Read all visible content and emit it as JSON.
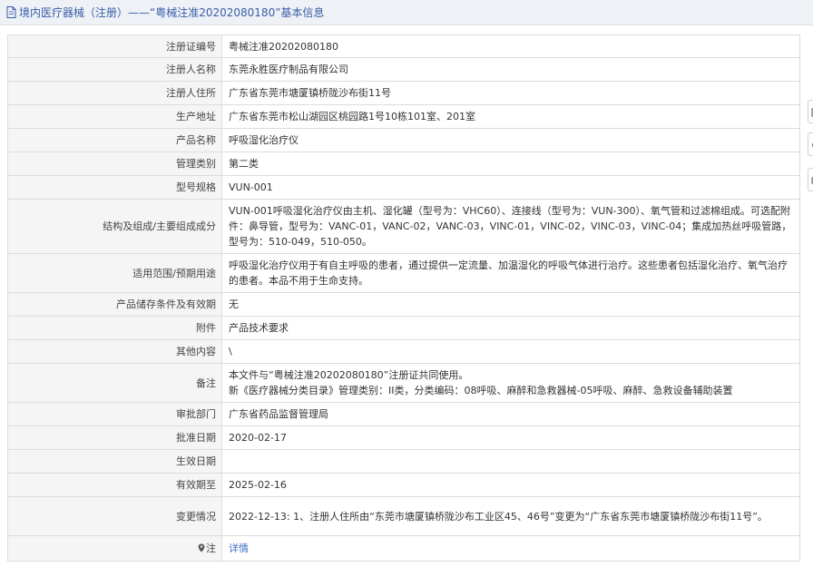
{
  "header": {
    "title": "境内医疗器械（注册）——“粤械注准20202080180”基本信息"
  },
  "rows": [
    {
      "label": "注册证编号",
      "value": "粤械注准20202080180"
    },
    {
      "label": "注册人名称",
      "value": "东莞永胜医疗制品有限公司"
    },
    {
      "label": "注册人住所",
      "value": "广东省东莞市塘厦镇桥陇沙布街11号"
    },
    {
      "label": "生产地址",
      "value": "广东省东莞市松山湖园区桃园路1号10栋101室、201室"
    },
    {
      "label": "产品名称",
      "value": "呼吸湿化治疗仪"
    },
    {
      "label": "管理类别",
      "value": "第二类"
    },
    {
      "label": "型号规格",
      "value": "VUN-001"
    },
    {
      "label": "结构及组成/主要组成成分",
      "value": "VUN-001呼吸湿化治疗仪由主机、湿化罐（型号为：VHC60）、连接线（型号为：VUN-300）、氧气管和过滤棉组成。可选配附件：鼻导管，型号为：VANC-01，VANC-02，VANC-03，VINC-01，VINC-02，VINC-03，VINC-04；集成加热丝呼吸管路，型号为：510-049，510-050。"
    },
    {
      "label": "适用范围/预期用途",
      "value": "呼吸湿化治疗仪用于有自主呼吸的患者，通过提供一定流量、加温湿化的呼吸气体进行治疗。这些患者包括湿化治疗、氧气治疗的患者。本品不用于生命支持。"
    },
    {
      "label": "产品储存条件及有效期",
      "value": "无"
    },
    {
      "label": "附件",
      "value": "产品技术要求"
    },
    {
      "label": "其他内容",
      "value": "\\"
    },
    {
      "label": "备注",
      "value_lines": [
        "本文件与“粤械注准20202080180”注册证共同使用。",
        "新《医疗器械分类目录》管理类别：II类，分类编码：08呼吸、麻醉和急救器械-05呼吸、麻醉、急救设备辅助装置"
      ]
    },
    {
      "label": "审批部门",
      "value": "广东省药品监督管理局"
    },
    {
      "label": "批准日期",
      "value": "2020-02-17"
    },
    {
      "label": "生效日期",
      "value": ""
    },
    {
      "label": "有效期至",
      "value": "2025-02-16"
    },
    {
      "label": "变更情况",
      "value": "2022-12-13: 1、注册人住所由“东莞市塘厦镇桥陇沙布工业区45、46号”变更为“广东省东莞市塘厦镇桥陇沙布街11号”。"
    },
    {
      "label": "注",
      "link": "详情"
    }
  ],
  "colors": {
    "header_bg": "#eef1f6",
    "header_text": "#3a5da8",
    "label_bg": "#f5f5f5",
    "link": "#3d6cc4"
  },
  "icons": {
    "title": "document-icon",
    "note": "location-pin-icon",
    "side_tabs": [
      "edge-tab-1",
      "edge-tab-2",
      "edge-tab-3"
    ]
  }
}
